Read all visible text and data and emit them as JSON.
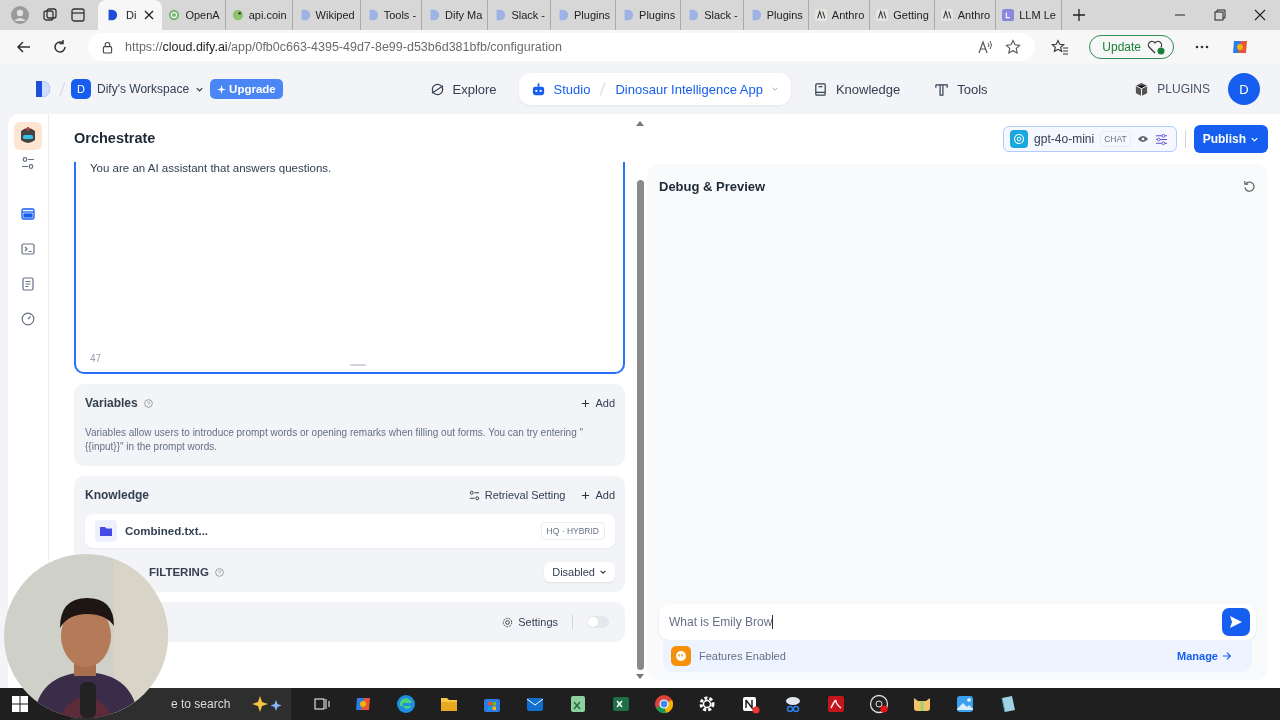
{
  "browser": {
    "tabs": [
      {
        "label": "Di",
        "selected": true
      },
      {
        "label": "OpenA",
        "selected": false
      },
      {
        "label": "api.coin",
        "selected": false
      },
      {
        "label": "Wikiped",
        "selected": false
      },
      {
        "label": "Tools -",
        "selected": false
      },
      {
        "label": "Dify Ma",
        "selected": false
      },
      {
        "label": "Slack -",
        "selected": false
      },
      {
        "label": "Plugins",
        "selected": false
      },
      {
        "label": "Plugins",
        "selected": false
      },
      {
        "label": "Slack -",
        "selected": false
      },
      {
        "label": "Plugins",
        "selected": false
      },
      {
        "label": "Anthro",
        "selected": false
      },
      {
        "label": "Getting",
        "selected": false
      },
      {
        "label": "Anthro",
        "selected": false
      },
      {
        "label": "LLM Le",
        "selected": false
      }
    ],
    "url": {
      "scheme": "https://",
      "host": "cloud.dify.ai",
      "path": "/app/0fb0c663-4395-49d7-8e99-d53b6d381bfb/configuration"
    },
    "update": "Update"
  },
  "nav": {
    "workspace_initial": "D",
    "workspace": "Dify's Workspace",
    "upgrade": "Upgrade",
    "avatar": "D",
    "plugins": "PLUGINS",
    "items": [
      {
        "label": "Explore",
        "selected": false
      },
      {
        "label": "Studio",
        "selected": true
      },
      {
        "label": "Knowledge",
        "selected": false
      },
      {
        "label": "Tools",
        "selected": false
      }
    ],
    "app_name": "Dinosaur Intelligence App"
  },
  "sidebar": [
    {
      "selected": false
    },
    {
      "selected": true
    },
    {
      "selected": false
    },
    {
      "selected": false
    },
    {
      "selected": false
    }
  ],
  "orchestrate": {
    "title": "Orchestrate",
    "prompt": "You are an AI assistant that answers questions.",
    "char_count": "47",
    "variables": {
      "title": "Variables",
      "add": "Add",
      "description": "Variables allow users to introduce prompt words or opening remarks when filling out forms. You can try entering \"{{input}}\" in the prompt words."
    },
    "knowledge": {
      "title": "Knowledge",
      "retrieval": "Retrieval Setting",
      "add": "Add",
      "items": [
        {
          "name": "Combined.txt...",
          "badge": "HQ · HYBRID"
        }
      ]
    },
    "metadata": {
      "label": "FILTERING",
      "value": "Disabled"
    },
    "feature": {
      "settings": "Settings",
      "on": false
    }
  },
  "model": {
    "name": "gpt-4o-mini",
    "mode": "CHAT",
    "publish": "Publish"
  },
  "debug": {
    "title": "Debug & Preview",
    "input": "What is Emily Brow",
    "features": "Features Enabled",
    "manage": "Manage"
  },
  "taskbar": {
    "search": "e to search"
  }
}
